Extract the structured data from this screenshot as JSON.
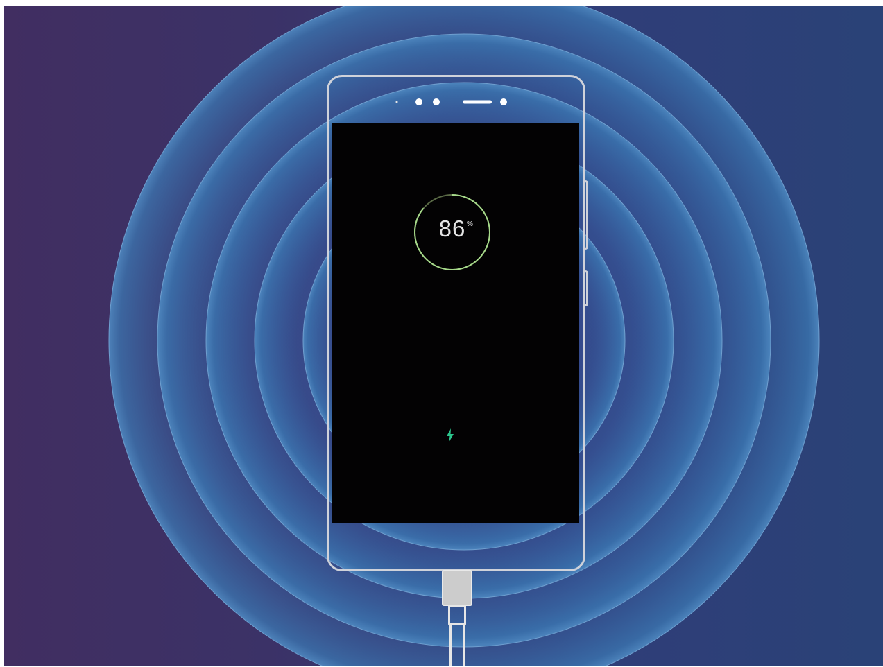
{
  "battery": {
    "percent_value": "86",
    "percent_sign": "%",
    "level_fraction": 0.86,
    "charging": true
  },
  "icons": {
    "charging": "lightning-bolt-icon"
  },
  "colors": {
    "ring_accent": "#a6d98a",
    "bolt": "#2bc48c",
    "screen": "#030203"
  }
}
